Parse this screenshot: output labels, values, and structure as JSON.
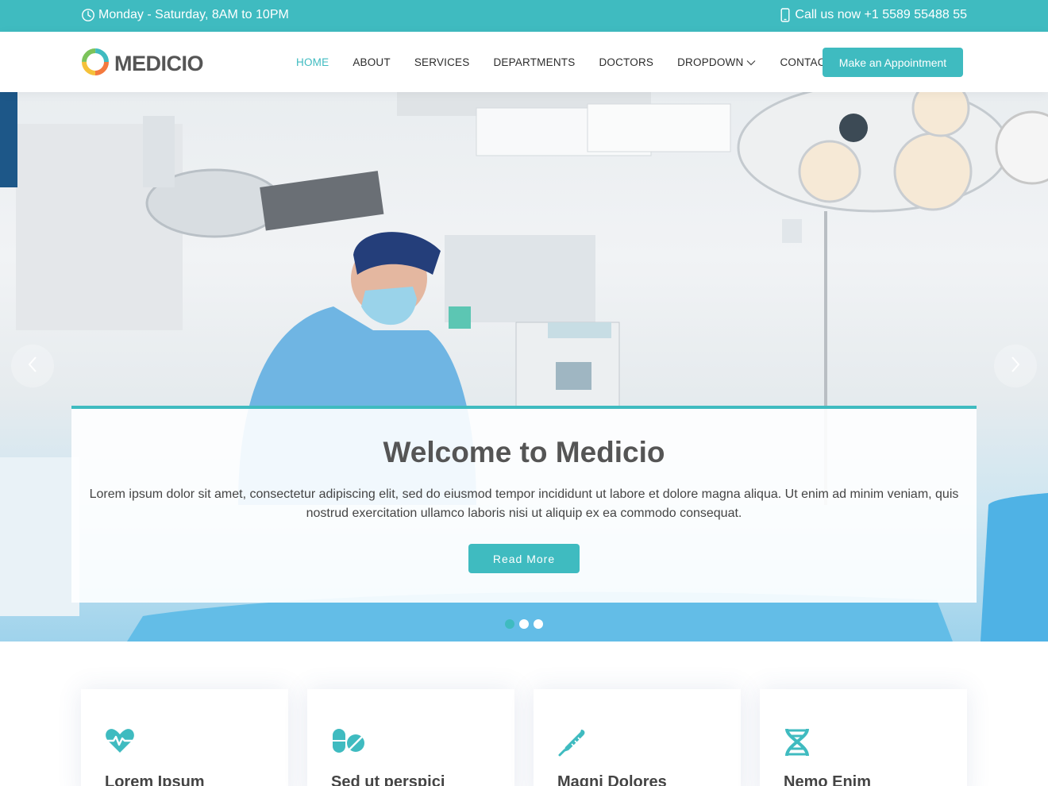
{
  "topbar": {
    "hours": "Monday - Saturday, 8AM to 10PM",
    "phone": "Call us now +1 5589 55488 55",
    "hours_icon": "clock-icon",
    "phone_icon": "phone-icon"
  },
  "header": {
    "logo_text": "MEDICIO",
    "nav": [
      {
        "label": "HOME",
        "active": true
      },
      {
        "label": "ABOUT"
      },
      {
        "label": "SERVICES"
      },
      {
        "label": "DEPARTMENTS"
      },
      {
        "label": "DOCTORS"
      },
      {
        "label": "DROPDOWN"
      },
      {
        "label": "CONTACT"
      }
    ],
    "appointment_button": "Make an Appointment"
  },
  "hero": {
    "title": "Welcome to Medicio",
    "text": "Lorem ipsum dolor sit amet, consectetur adipiscing elit, sed do eiusmod tempor incididunt ut labore et dolore magna aliqua. Ut enim ad minim veniam, quis nostrud exercitation ullamco laboris nisi ut aliquip ex ea commodo consequat.",
    "button": "Read More",
    "slides": 3,
    "active_slide": 1
  },
  "features": [
    {
      "title": "Lorem Ipsum",
      "icon": "heart-pulse-icon"
    },
    {
      "title": "Sed ut perspici",
      "icon": "capsule-pill-icon"
    },
    {
      "title": "Magni Dolores",
      "icon": "thermometer-icon"
    },
    {
      "title": "Nemo Enim",
      "icon": "dna-icon"
    }
  ],
  "colors": {
    "accent": "#3fbbc0",
    "text": "#444444"
  }
}
